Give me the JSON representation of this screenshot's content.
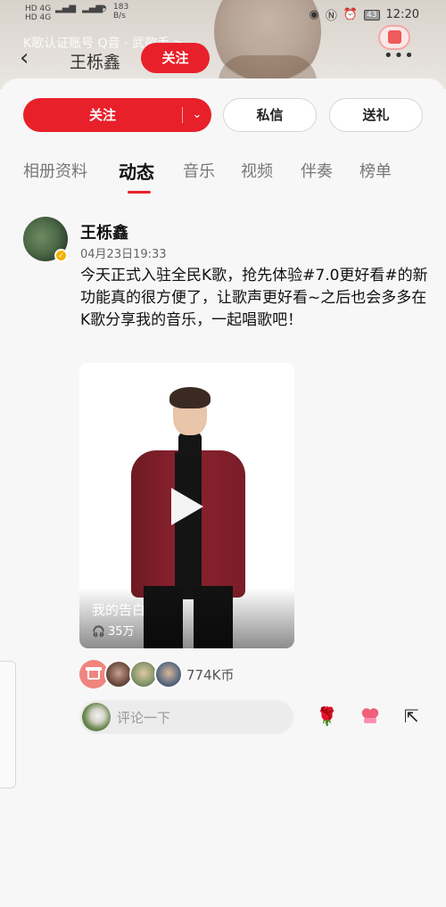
{
  "status_bar": {
    "network_1": "HD 4G",
    "network_2": "HD 4G",
    "speed_value": "183",
    "speed_unit": "B/s",
    "battery": "43",
    "time": "12:20"
  },
  "header": {
    "cert_text": "K歌认证账号   Q音 · 武歌手 >",
    "name": "王栎鑫",
    "follow_label": "关注"
  },
  "actions": {
    "follow_label": "关注",
    "message_label": "私信",
    "gift_label": "送礼"
  },
  "tabs": [
    {
      "label": "相册资料"
    },
    {
      "label": "动态"
    },
    {
      "label": "音乐"
    },
    {
      "label": "视频"
    },
    {
      "label": "伴奏"
    },
    {
      "label": "榜单"
    }
  ],
  "post": {
    "author": "王栎鑫",
    "time": "04月23日19:33",
    "text": "今天正式入驻全民K歌，抢先体验#7.0更好看#的新功能真的很方便了，让歌声更好看~之后也会多多在K歌分享我的音乐，一起唱歌吧！",
    "video": {
      "title": "我的告白",
      "plays": "35万"
    },
    "coins": "774K币",
    "comment_placeholder": "评论一下"
  },
  "icons": [
    "back-icon",
    "more-icon",
    "chevron-down-icon",
    "play-icon",
    "headphones-icon",
    "gift-icon",
    "rose-icon",
    "heart-icon",
    "share-icon",
    "verified-icon"
  ],
  "colors": {
    "accent": "#e8202a",
    "verified": "#f4b400"
  }
}
